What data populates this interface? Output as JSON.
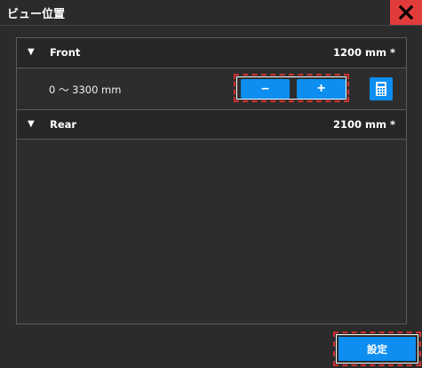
{
  "window": {
    "title": "ビュー位置",
    "close_icon": "close-icon"
  },
  "sections": {
    "front": {
      "label": "Front",
      "value": "1200 mm *",
      "range": "0 ～ 3300 mm",
      "minus_label": "–",
      "plus_label": "+",
      "calc_icon": "calculator-icon"
    },
    "rear": {
      "label": "Rear",
      "value": "2100 mm *"
    }
  },
  "footer": {
    "set_label": "設定"
  },
  "colors": {
    "accent": "#0d8ef0",
    "close": "#e23b3b",
    "highlight_dash": "#d0332f",
    "background": "#2b2b2b"
  }
}
